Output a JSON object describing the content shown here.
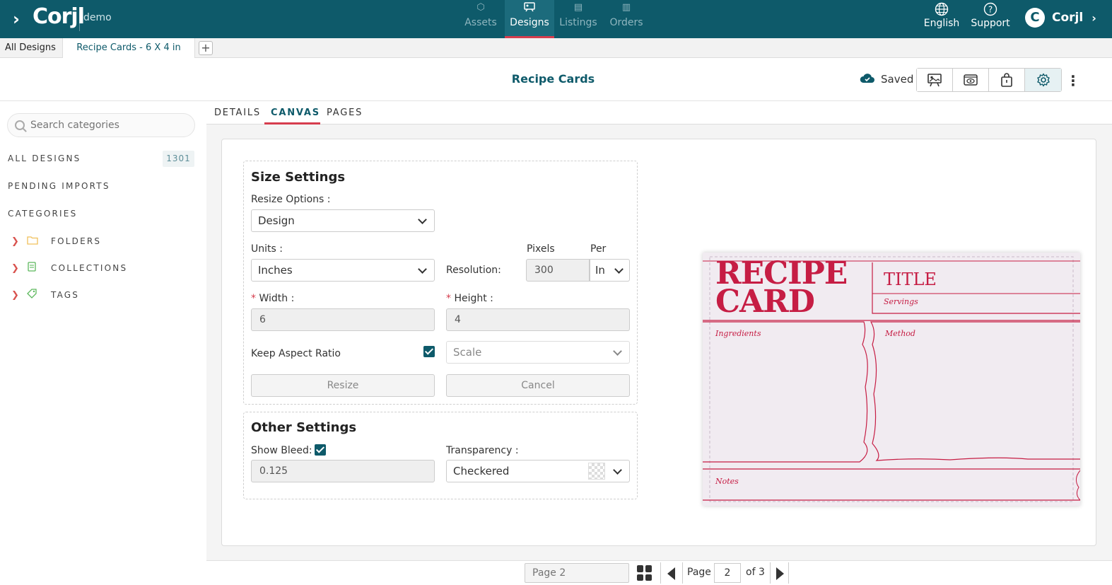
{
  "topbar": {
    "logo": "Corjl",
    "account": "demo",
    "nav": [
      {
        "label": "Assets",
        "icon": "cube-icon"
      },
      {
        "label": "Designs",
        "icon": "designs-icon"
      },
      {
        "label": "Listings",
        "icon": "listings-icon"
      },
      {
        "label": "Orders",
        "icon": "orders-icon"
      }
    ],
    "language": "English",
    "support": "Support",
    "user": "Corjl",
    "user_initial": "C"
  },
  "tabs": {
    "all_designs": "All Designs",
    "current": "Recipe Cards - 6 X 4 in",
    "add": "+"
  },
  "header": {
    "title": "Recipe Cards",
    "saved": "Saved"
  },
  "sidebar": {
    "search_placeholder": "Search categories",
    "all_designs": "ALL DESIGNS",
    "all_designs_count": "1301",
    "pending_imports": "PENDING IMPORTS",
    "categories": "CATEGORIES",
    "items": [
      {
        "label": "FOLDERS",
        "icon": "folder-icon"
      },
      {
        "label": "COLLECTIONS",
        "icon": "collection-icon"
      },
      {
        "label": "TAGS",
        "icon": "tag-icon"
      }
    ]
  },
  "subtabs": [
    "DETAILS",
    "CANVAS",
    "PAGES"
  ],
  "size_settings": {
    "title": "Size Settings",
    "resize_options_label": "Resize Options :",
    "resize_options_value": "Design",
    "units_label": "Units :",
    "units_value": "Inches",
    "resolution_label": "Resolution:",
    "pixels_label": "Pixels",
    "per_label": "Per",
    "resolution_value": "300",
    "per_value": "In",
    "width_label": "Width :",
    "width_value": "6",
    "height_label": "Height :",
    "height_value": "4",
    "keep_aspect_label": "Keep Aspect Ratio",
    "keep_aspect_checked": true,
    "scale_value": "Scale",
    "resize_button": "Resize",
    "cancel_button": "Cancel"
  },
  "other_settings": {
    "title": "Other Settings",
    "show_bleed_label": "Show Bleed:",
    "show_bleed_checked": true,
    "bleed_value": "0.125",
    "transparency_label": "Transparency :",
    "transparency_value": "Checkered"
  },
  "card": {
    "line1": "RECIPE",
    "line2": "CARD",
    "title": "TITLE",
    "servings": "Servings",
    "ingredients": "Ingredients",
    "method": "Method",
    "notes": "Notes"
  },
  "pager": {
    "page_name": "Page 2",
    "page_label": "Page",
    "current_page": "2",
    "of_label": "of 3"
  },
  "colors": {
    "brand": "#0e5a6a",
    "accent": "#d63d4e",
    "card_red": "#c61d44"
  }
}
